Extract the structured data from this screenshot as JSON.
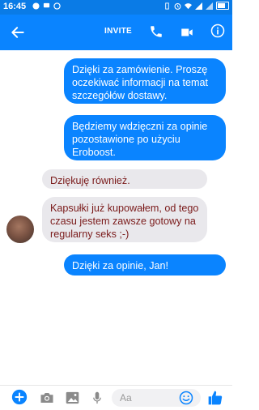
{
  "status_bar": {
    "time": "16:45",
    "battery_level": 0.75
  },
  "header": {
    "invite_label": "INVITE",
    "icons": [
      "back-icon",
      "call-icon",
      "video-icon",
      "info-icon"
    ]
  },
  "messages": [
    {
      "direction": "outgoing",
      "text": "Dzięki za zamówienie. Proszę oczekiwać informacji na temat szczegółów dostawy."
    },
    {
      "direction": "outgoing",
      "text": "Będziemy wdzięczni za opinie pozostawione po użyciu Eroboost."
    },
    {
      "direction": "incoming",
      "text": "Dziękuję również."
    },
    {
      "direction": "incoming",
      "text": "Kapsułki już kupowałem, od tego czasu jestem zawsze gotowy na regularny seks ;-)"
    },
    {
      "direction": "outgoing",
      "text": "Dzięki za opinie, Jan!"
    }
  ],
  "composer": {
    "placeholder": "Aa"
  },
  "colors": {
    "accent": "#0a84ff",
    "incoming_bubble": "#e9e8ec",
    "incoming_text": "#7a1a1a"
  }
}
